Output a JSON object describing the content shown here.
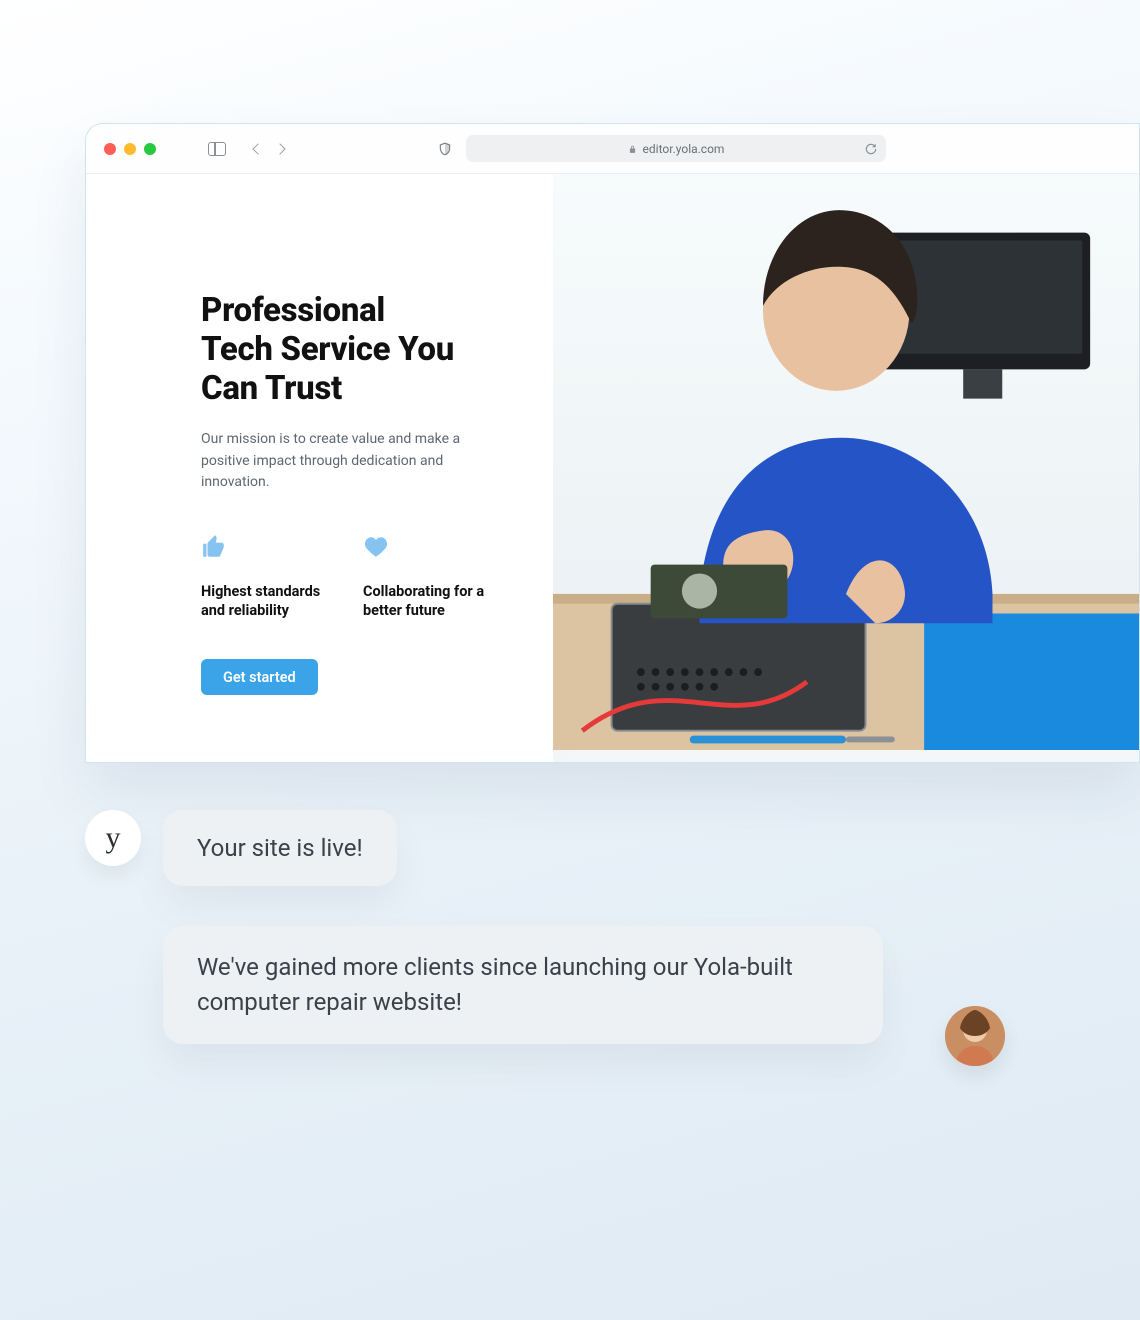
{
  "browser": {
    "url_host": "editor.yola.com"
  },
  "hero": {
    "title_line1": "Professional",
    "title_line2": "Tech Service You",
    "title_line3": "Can Trust",
    "subtitle": "Our mission is to create value and make a positive impact through dedication and innovation.",
    "features": [
      {
        "icon": "thumbs-up-icon",
        "text": "Highest standards and reliability"
      },
      {
        "icon": "heart-icon",
        "text": "Collaborating for a better future"
      }
    ],
    "cta_label": "Get started"
  },
  "chat": {
    "msg1": "Your site is live!",
    "msg2": "We've gained more clients since launching our Yola-built computer repair website!",
    "brand_initial": "y"
  }
}
